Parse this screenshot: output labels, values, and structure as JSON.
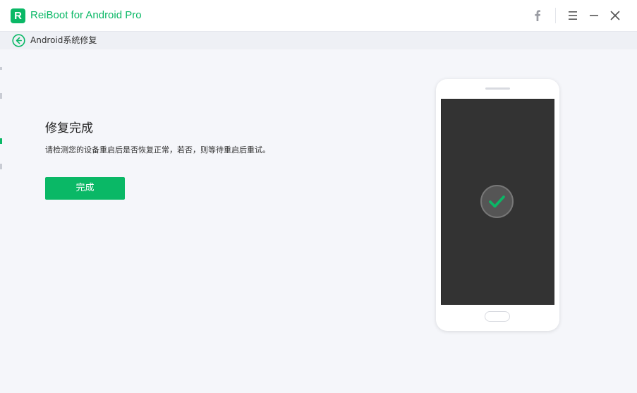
{
  "app": {
    "title": "ReiBoot for Android Pro",
    "logo_letter": "R"
  },
  "titlebar": {
    "icons": [
      "facebook-icon",
      "menu-icon",
      "minimize-icon",
      "close-icon"
    ]
  },
  "breadcrumb": {
    "label": "Android系统修复"
  },
  "main": {
    "heading": "修复完成",
    "description": "请检测您的设备重启后是否恢复正常，若否，则等待重启后重试。",
    "done_button": "完成"
  },
  "colors": {
    "brand": "#0ab866",
    "background": "#f5f6fa",
    "screen": "#333333"
  }
}
